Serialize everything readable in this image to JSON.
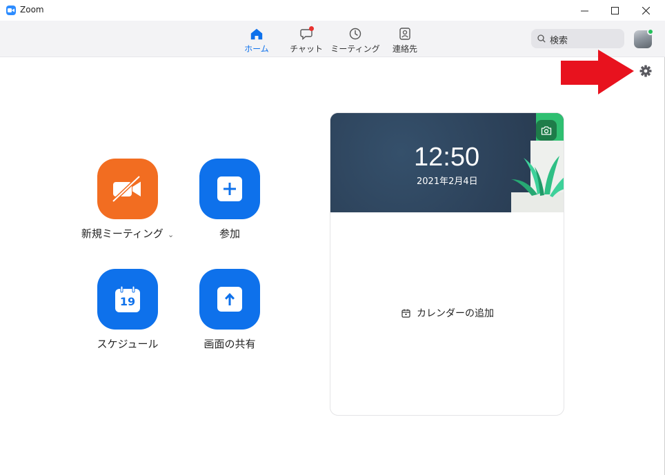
{
  "window": {
    "title": "Zoom"
  },
  "nav": {
    "tabs": [
      {
        "label": "ホーム",
        "icon": "home-icon",
        "active": true
      },
      {
        "label": "チャット",
        "icon": "chat-icon",
        "active": false
      },
      {
        "label": "ミーティング",
        "icon": "clock-icon",
        "active": false
      },
      {
        "label": "連絡先",
        "icon": "contacts-icon",
        "active": false
      }
    ]
  },
  "search": {
    "label": "検索"
  },
  "actions": {
    "new_meeting": "新規ミーティング",
    "join": "参加",
    "schedule": "スケジュール",
    "share_screen": "画面の共有"
  },
  "calendar_icon_day": "19",
  "clock": {
    "time": "12:50",
    "date": "2021年2月4日"
  },
  "calendar": {
    "add_label": "カレンダーの追加"
  },
  "colors": {
    "accent": "#0e71eb",
    "orange": "#f26d21",
    "arrow": "#e8121e"
  }
}
